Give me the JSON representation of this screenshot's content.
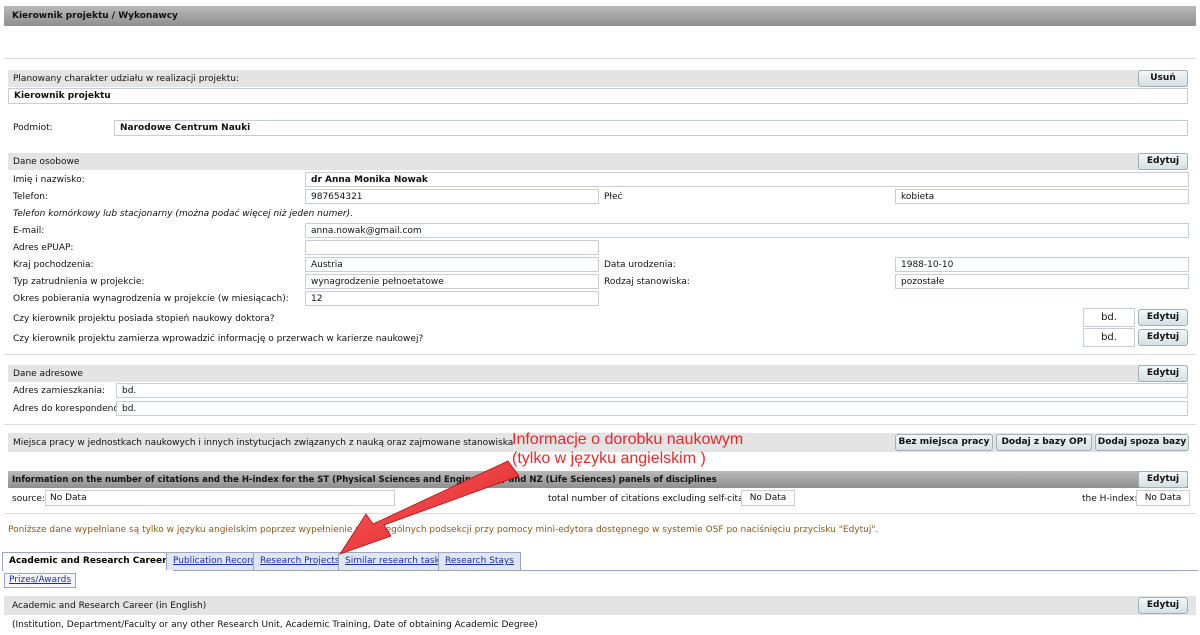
{
  "header": {
    "title": "Kierownik projektu / Wykonawcy"
  },
  "role": {
    "label": "Planowany charakter udziału w realizacji projektu:",
    "value": "Kierownik projektu",
    "remove_label": "Usuń"
  },
  "entity": {
    "label": "Podmiot:",
    "value": "Narodowe Centrum Nauki"
  },
  "personal": {
    "title": "Dane osobowe",
    "edit_label": "Edytuj",
    "name_label": "Imię i nazwisko:",
    "name_value": "dr Anna Monika Nowak",
    "phone_label": "Telefon:",
    "phone_value": "987654321",
    "gender_label": "Płeć",
    "gender_value": "kobieta",
    "phone_hint": "Telefon komórkowy lub stacjonarny (można podać więcej niż jeden numer).",
    "email_label": "E-mail:",
    "email_value": "anna.nowak@gmail.com",
    "epuap_label": "Adres ePUAP:",
    "epuap_value": "",
    "country_label": "Kraj pochodzenia:",
    "country_value": "Austria",
    "birth_label": "Data urodzenia:",
    "birth_value": "1988-10-10",
    "employment_label": "Typ zatrudnienia w projekcie:",
    "employment_value": "wynagrodzenie pełnoetatowe",
    "position_label": "Rodzaj stanowiska:",
    "position_value": "pozostałe",
    "period_label": "Okres pobierania wynagrodzenia w projekcie (w miesiącach):",
    "period_value": "12",
    "doctorate_question": "Czy kierownik projektu posiada stopień naukowy doktora?",
    "doctorate_value": "bd.",
    "break_question": "Czy kierownik projektu zamierza wprowadzić informację o przerwach w karierze naukowej?",
    "break_value": "bd."
  },
  "address": {
    "title": "Dane adresowe",
    "edit_label": "Edytuj",
    "home_label": "Adres zamieszkania:",
    "home_value": "bd.",
    "mail_label": "Adres do korespondencji:",
    "mail_value": "bd."
  },
  "workplaces": {
    "label": "Miejsca pracy w jednostkach naukowych i innych instytucjach związanych z nauką oraz zajmowane stanowiska",
    "btn_none": "Bez miejsca pracy",
    "btn_opi": "Dodaj z bazy OPI",
    "btn_outside": "Dodaj spoza bazy"
  },
  "annotation": {
    "line1": "Informacje o dorobku naukowym",
    "line2": "(tylko w języku angielskim )",
    "color": "#e8282a"
  },
  "citations": {
    "title": "Information on the number of citations and the H-index for the ST (Physical Sciences and Engineering) and NZ (Life Sciences) panels of disciplines",
    "edit_label": "Edytuj",
    "source_label": "source:",
    "source_value": "No Data",
    "total_label": "total number of citations excluding self-citations:",
    "total_value": "No Data",
    "hindex_label": "the H-index:",
    "hindex_value": "No Data"
  },
  "notice": "Poniższe dane wypełniane są tylko w języku angielskim poprzez wypełnienie poszczególnych podsekcji przy pomocy mini-edytora dostępnego w systemie OSF po naciśnięciu przycisku \"Edytuj\".",
  "tabs": [
    {
      "label": "Academic and Research Career"
    },
    {
      "label": "Publication Record"
    },
    {
      "label": "Research Projects"
    },
    {
      "label": "Similar research tasks"
    },
    {
      "label": "Research Stays"
    }
  ],
  "subtabs": [
    {
      "label": "Prizes/Awards"
    }
  ],
  "career": {
    "title": "Academic and Research Career (in English)",
    "edit_label": "Edytuj",
    "hint": "(Institution, Department/Faculty or any other Research Unit, Academic Training, Date of obtaining Academic Degree)"
  }
}
